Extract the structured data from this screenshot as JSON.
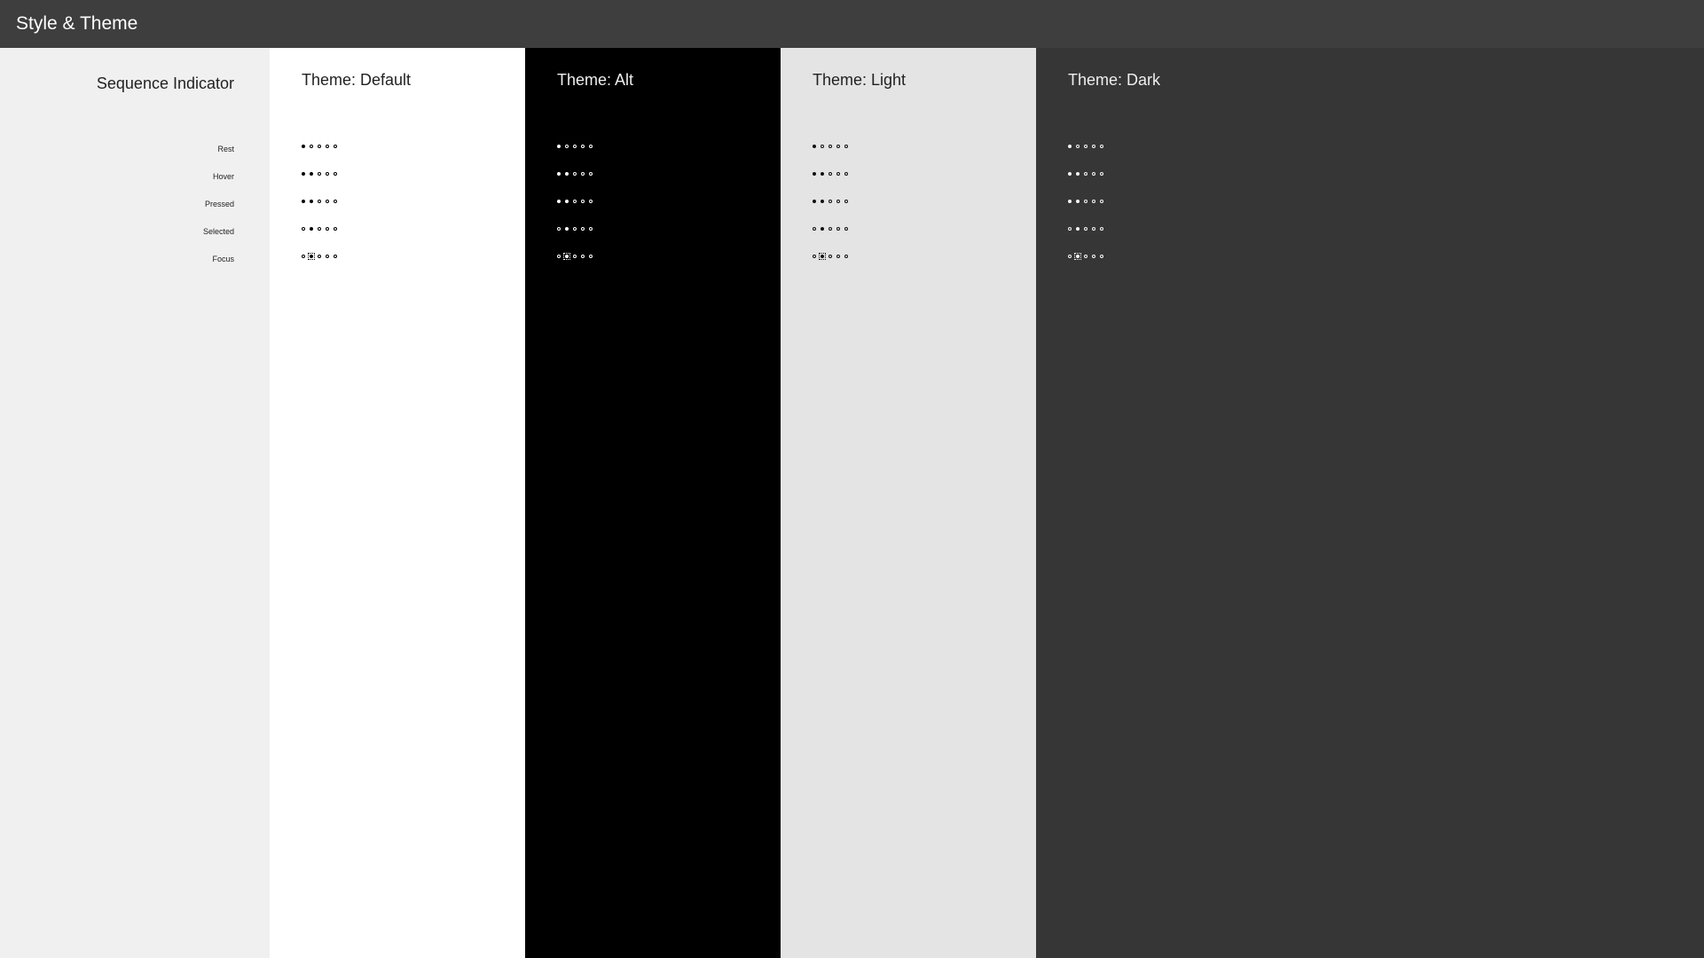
{
  "window": {
    "title": "Style & Theme"
  },
  "section": {
    "title": "Sequence Indicator"
  },
  "states": [
    {
      "key": "rest",
      "label": "Rest",
      "filled": [
        0
      ],
      "focus": null
    },
    {
      "key": "hover",
      "label": "Hover",
      "filled": [
        0,
        1
      ],
      "focus": null
    },
    {
      "key": "pressed",
      "label": "Pressed",
      "filled": [
        0,
        1
      ],
      "focus": null
    },
    {
      "key": "selected",
      "label": "Selected",
      "filled": [
        1
      ],
      "focus": null
    },
    {
      "key": "focus",
      "label": "Focus",
      "filled": [
        1
      ],
      "focus": 1
    }
  ],
  "themes": [
    {
      "key": "default",
      "label": "Theme: Default"
    },
    {
      "key": "alt",
      "label": "Theme: Alt"
    },
    {
      "key": "light",
      "label": "Theme: Light"
    },
    {
      "key": "dark",
      "label": "Theme: Dark"
    }
  ],
  "dotCount": 5
}
